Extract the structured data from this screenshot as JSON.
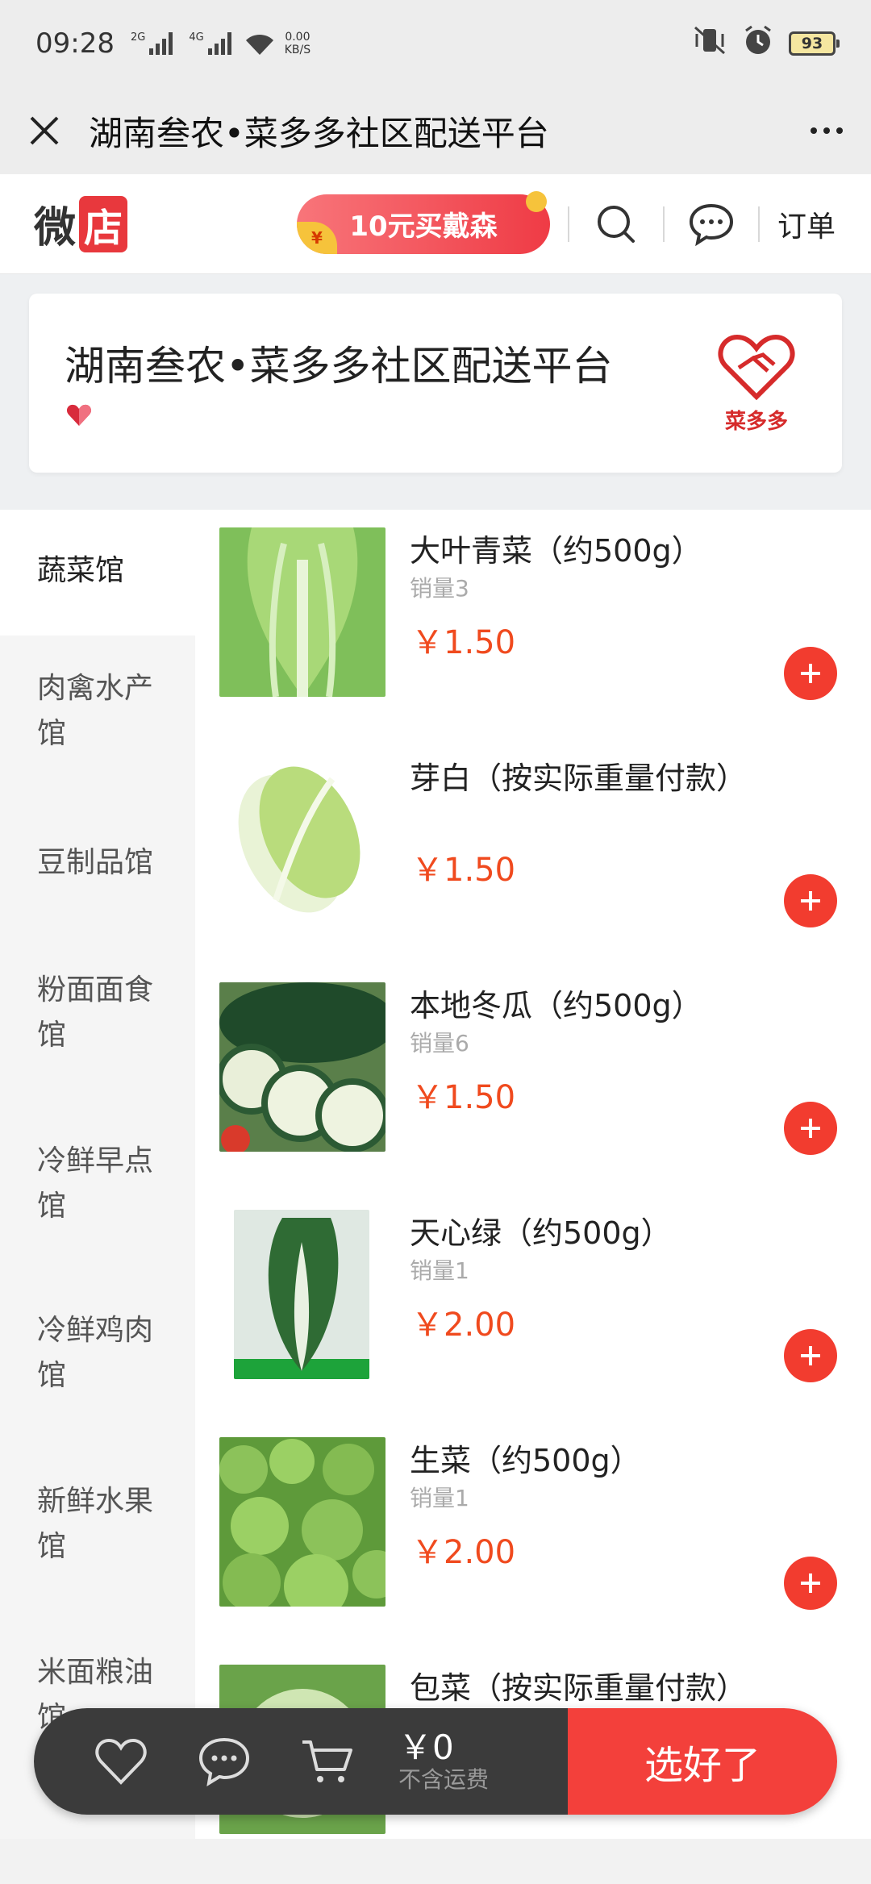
{
  "status_bar": {
    "time": "09:28",
    "net1": "2G",
    "net2": "4G",
    "speed_value": "0.00",
    "speed_unit": "KB/S",
    "battery": "93"
  },
  "title_bar": {
    "title": "湖南叁农•菜多多社区配送平台"
  },
  "shop_header": {
    "logo_a": "微",
    "logo_b": "店",
    "promo": "10元买戴森",
    "order": "订单"
  },
  "store": {
    "name": "湖南叁农•菜多多社区配送平台",
    "brand_name": "菜多多"
  },
  "categories": [
    {
      "label": "蔬菜馆"
    },
    {
      "label": "肉禽水产馆"
    },
    {
      "label": "豆制品馆"
    },
    {
      "label": "粉面面食馆"
    },
    {
      "label": "冷鲜早点馆"
    },
    {
      "label": "冷鲜鸡肉馆"
    },
    {
      "label": "新鲜水果馆"
    },
    {
      "label": "米面粮油馆"
    }
  ],
  "products": [
    {
      "name": "大叶青菜（约500g）",
      "sales": "销量3",
      "price": "￥1.50"
    },
    {
      "name": "芽白（按实际重量付款）",
      "sales": "",
      "price": "￥1.50"
    },
    {
      "name": "本地冬瓜（约500g）",
      "sales": "销量6",
      "price": "￥1.50"
    },
    {
      "name": "天心绿（约500g）",
      "sales": "销量1",
      "price": "￥2.00"
    },
    {
      "name": "生菜（约500g）",
      "sales": "销量1",
      "price": "￥2.00"
    },
    {
      "name": "包菜（按实际重量付款）",
      "sales": "",
      "price": ""
    }
  ],
  "cart": {
    "amount": "￥0",
    "note": "不含运费",
    "checkout": "选好了"
  }
}
